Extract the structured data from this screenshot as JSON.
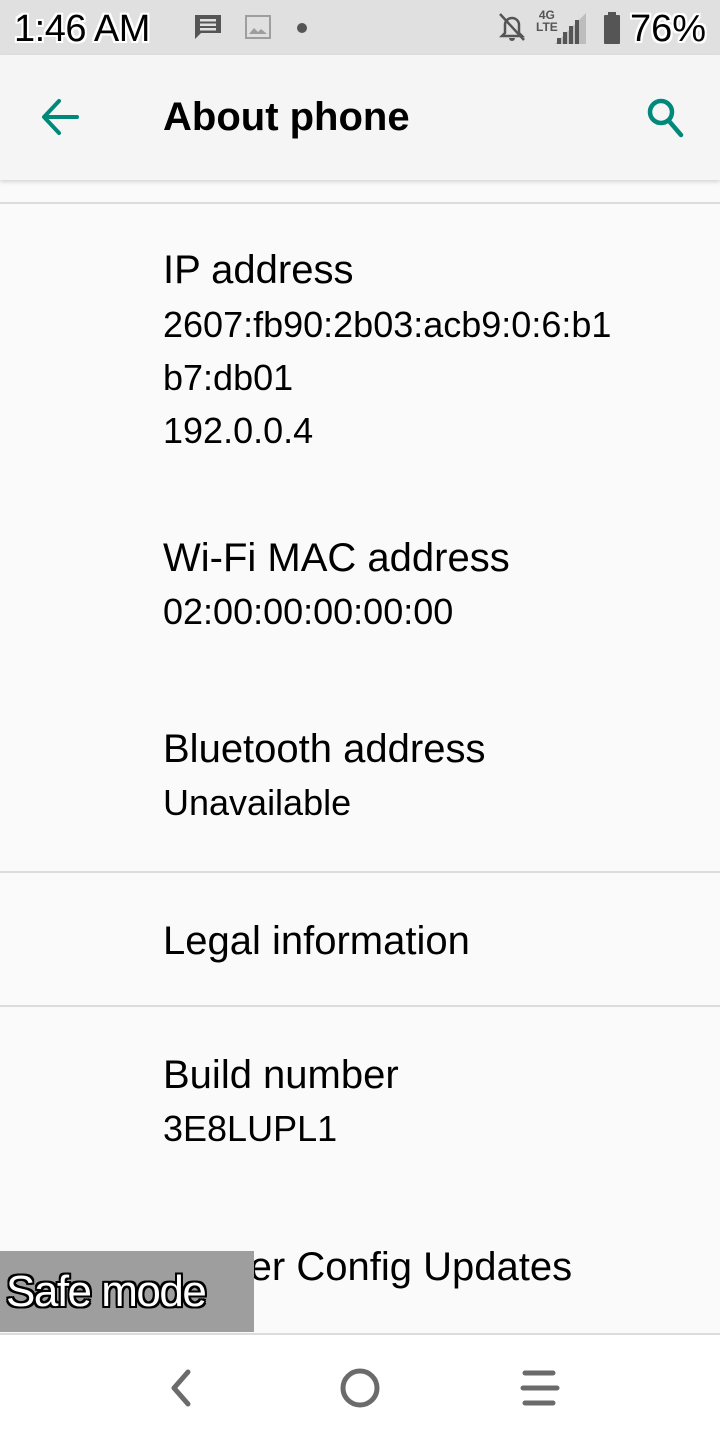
{
  "status_bar": {
    "time": "1:46 AM",
    "notification_icons": [
      "message-icon",
      "image-icon",
      "more-dot-icon"
    ],
    "system_icons": [
      "notifications-off-icon",
      "network-4g-lte-icon",
      "signal-icon",
      "battery-icon"
    ],
    "network_type_top": "4G",
    "network_type_bottom": "LTE",
    "battery_percent": "76%"
  },
  "app_bar": {
    "title": "About phone",
    "back_icon": "arrow-back-icon",
    "search_icon": "search-icon",
    "accent_color": "#00897b"
  },
  "preferences": [
    {
      "title": "IP address",
      "summary": "2607:fb90:2b03:acb9:0:6:b1\nb7:db01\n192.0.0.4"
    },
    {
      "title": "Wi-Fi MAC address",
      "summary": "02:00:00:00:00:00"
    },
    {
      "title": "Bluetooth address",
      "summary": "Unavailable"
    },
    {
      "title": "Legal information",
      "summary": ""
    },
    {
      "title": "Build number",
      "summary": "3E8LUPL1"
    },
    {
      "title": "Carrier Config Updates",
      "summary": ""
    }
  ],
  "overlay": {
    "safe_mode_label": "Safe mode"
  },
  "nav_bar": {
    "back": "nav-back-icon",
    "home": "nav-home-icon",
    "recents": "nav-recents-icon"
  }
}
